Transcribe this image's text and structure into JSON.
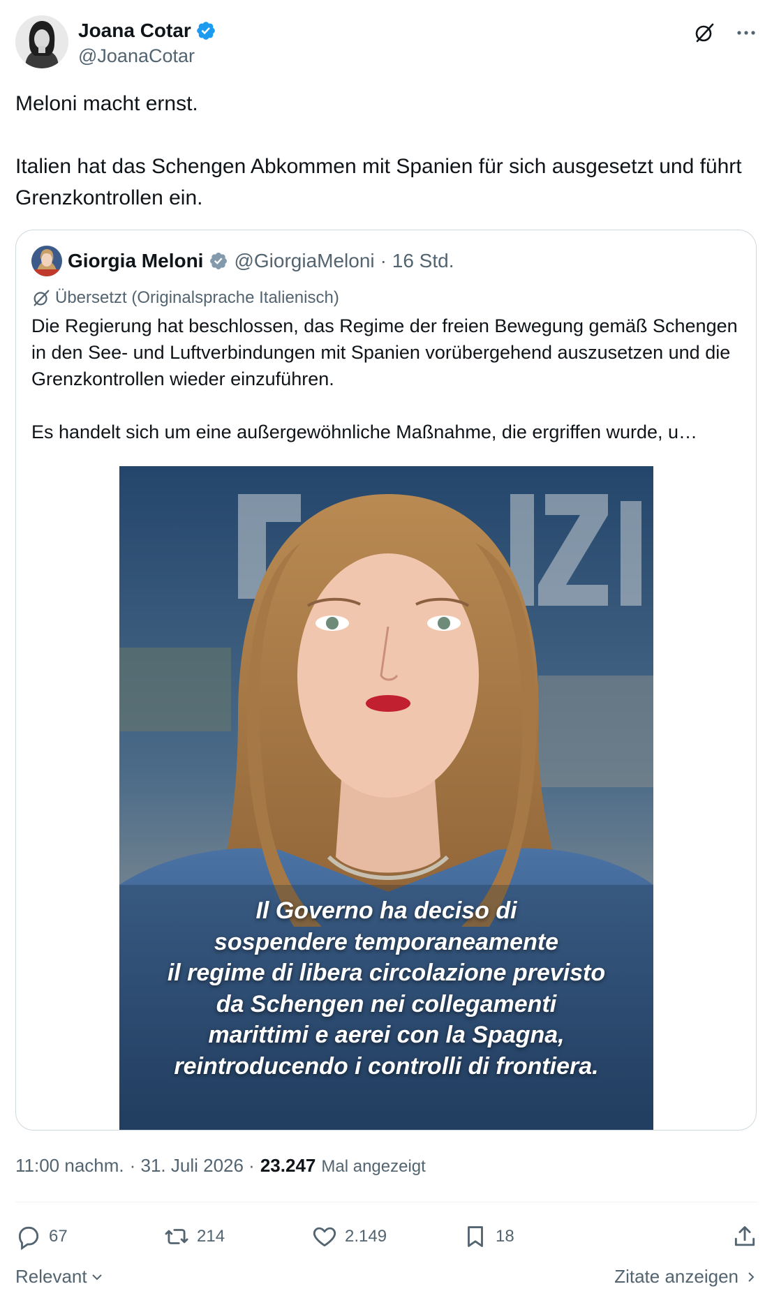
{
  "author": {
    "name": "Joana Cotar",
    "handle": "@JoanaCotar",
    "verified": true
  },
  "icons": {
    "verified_color": "#1d9bf0",
    "quoted_verified_color": "#829aab",
    "grok": "grok-icon",
    "more": "more-options-icon"
  },
  "tweet": {
    "paragraph1": "Meloni macht ernst.",
    "paragraph2": "Italien hat das Schengen Abkommen mit Spanien für sich ausgesetzt und führt Grenzkontrollen ein."
  },
  "quoted": {
    "name": "Giorgia Meloni",
    "handle": "@GiorgiaMeloni",
    "time": "· 16 Std.",
    "translated_note": "Übersetzt (Originalsprache Italienisch)",
    "paragraph1": "Die Regierung hat beschlossen, das Regime der freien Bewegung gemäß Schengen in den See- und Luftverbindungen mit Spanien vorübergehend auszusetzen und die Grenzkontrollen wieder einzuführen.",
    "paragraph2": "Es handelt sich um eine außergewöhnliche Maßnahme, die ergriffen wurde, u…",
    "image": {
      "overlay_lines": [
        "Il Governo ha deciso di",
        "sospendere temporaneamente",
        "il regime di libera circolazione previsto",
        "da Schengen nei collegamenti",
        "marittimi e aerei con la Spagna,",
        "reintroducendo i controlli di frontiera."
      ]
    }
  },
  "meta": {
    "time": "11:00 nachm.",
    "date": "· 31. Juli 2026 ·",
    "views": "23.247",
    "views_label": "Mal angezeigt"
  },
  "actions": {
    "replies": "67",
    "reposts": "214",
    "likes": "2.149",
    "bookmarks": "18"
  },
  "footer": {
    "sort": "Relevant",
    "quotes_link": "Zitate anzeigen"
  }
}
